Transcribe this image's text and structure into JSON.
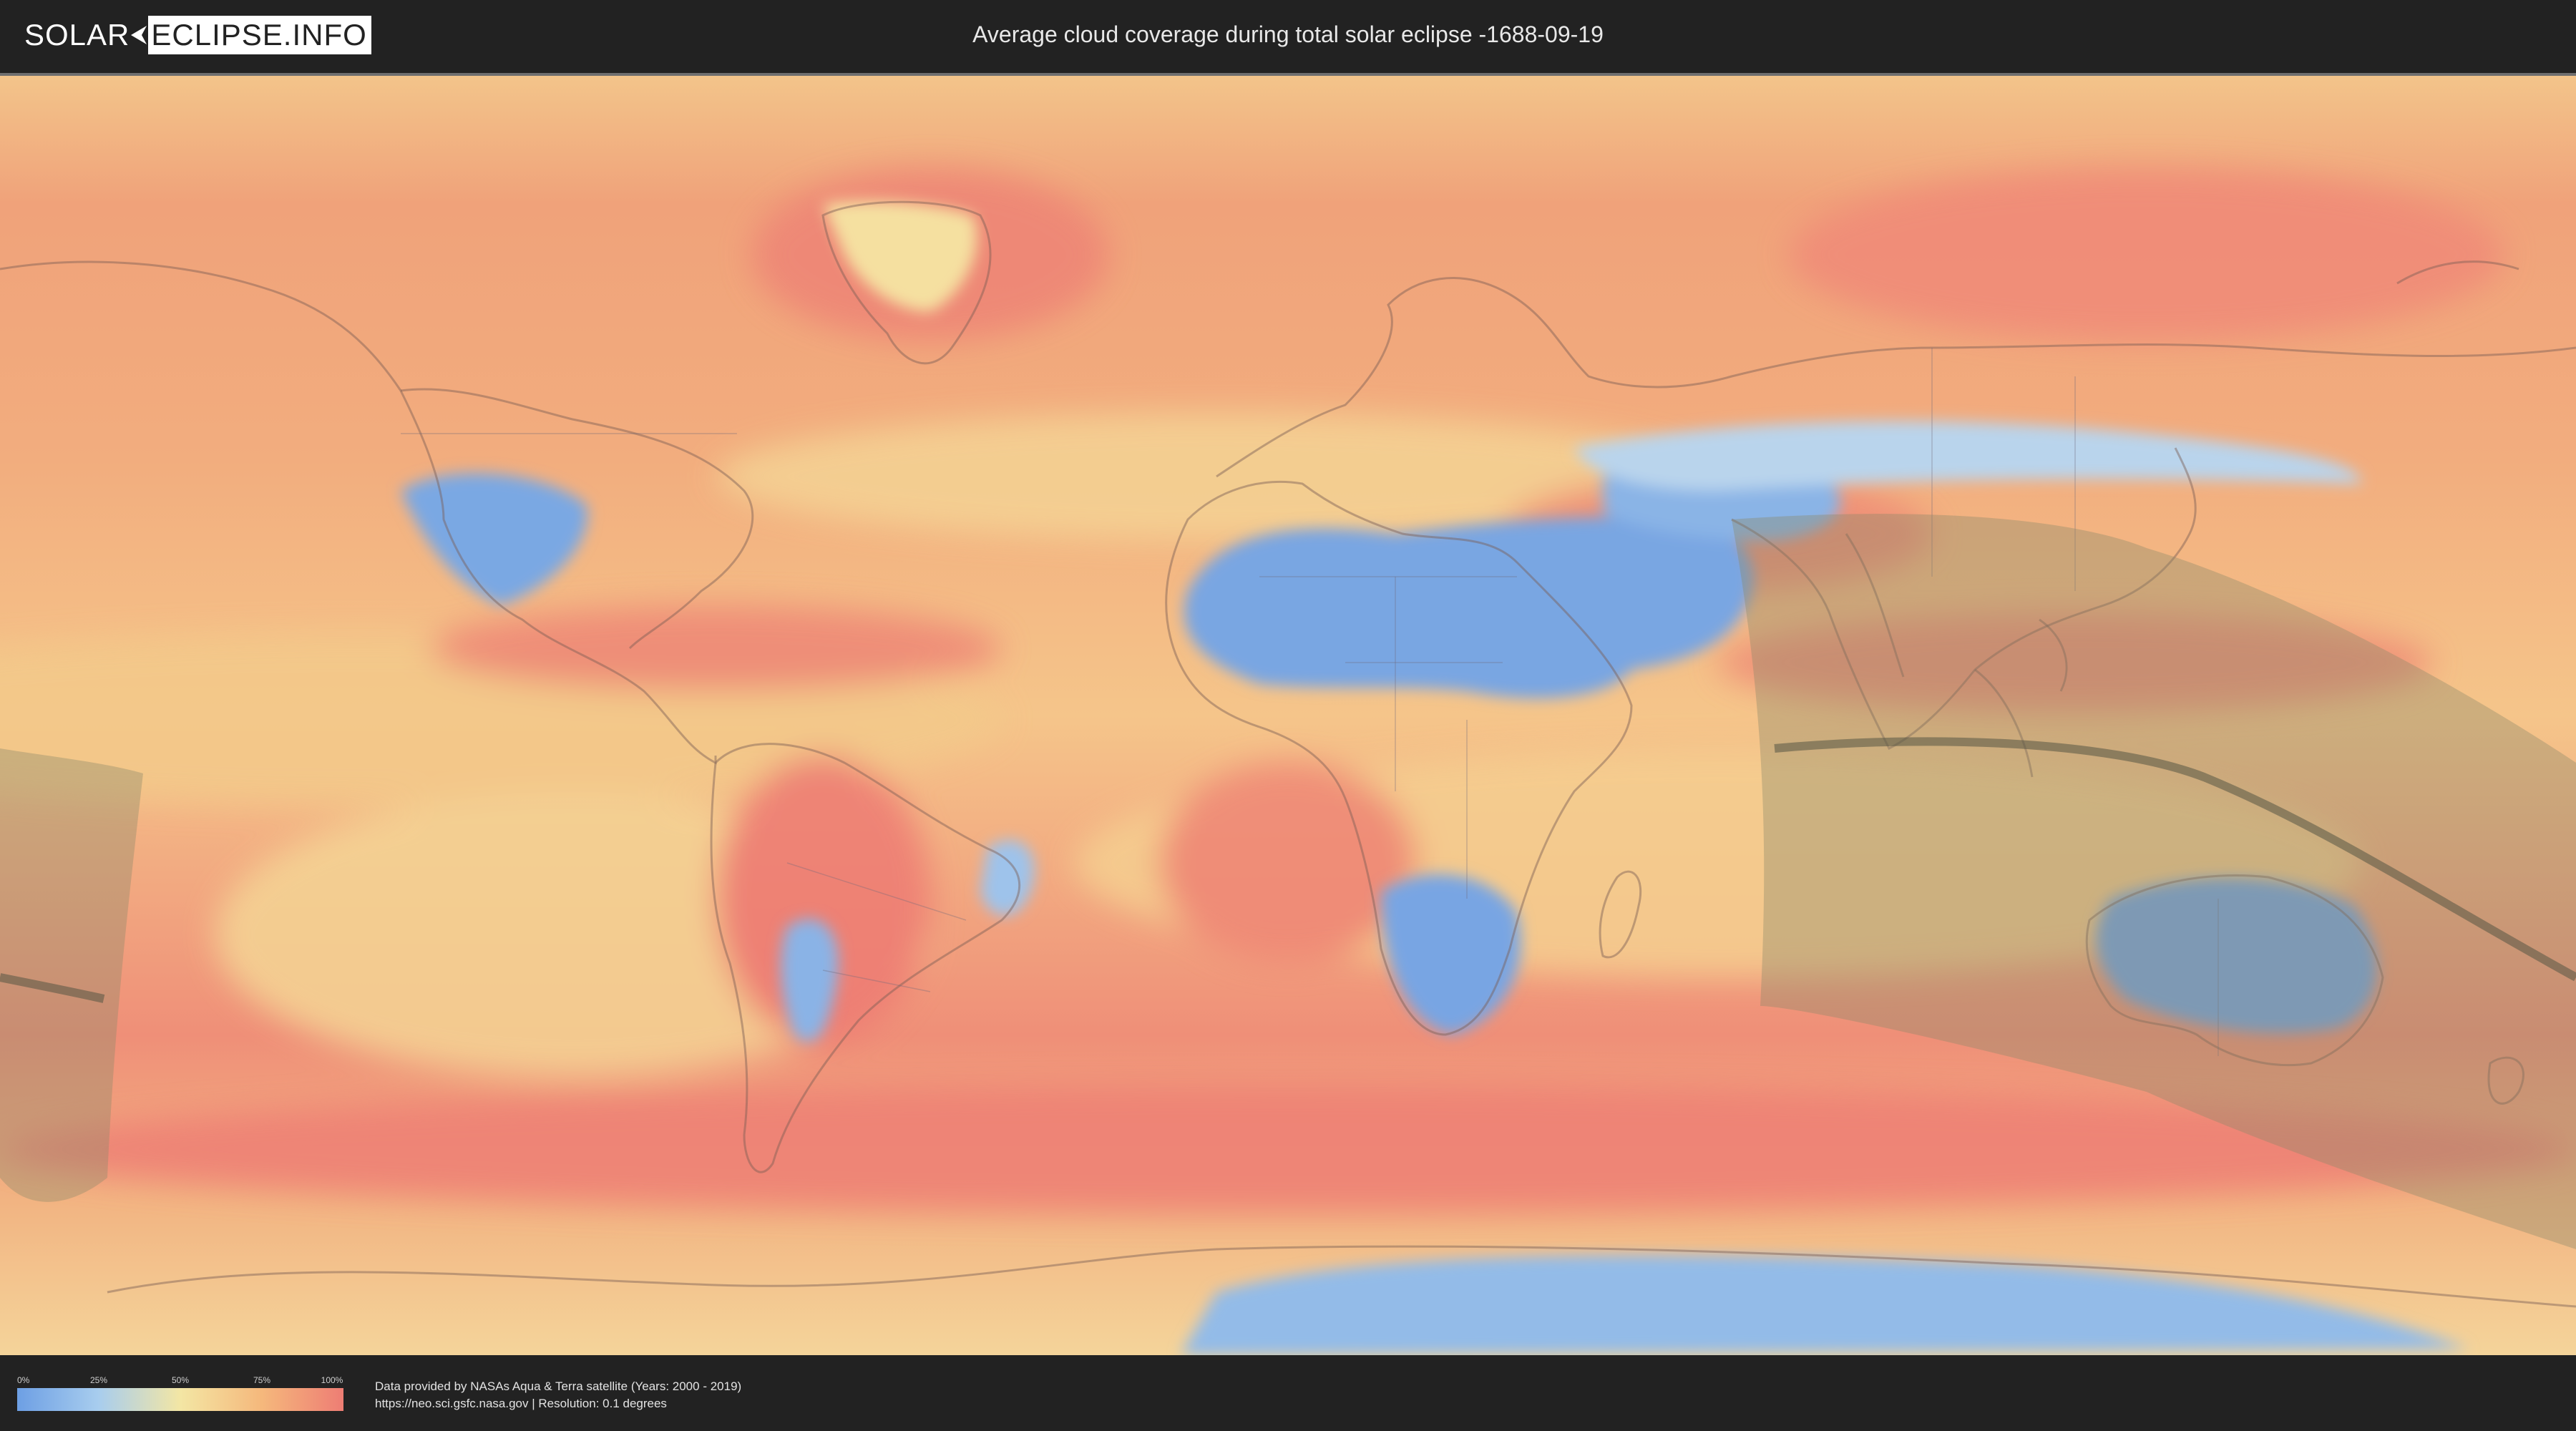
{
  "header": {
    "logo_left": "SOLAR",
    "logo_right": "ECLIPSE.INFO",
    "title": "Average cloud coverage during total solar eclipse -1688-09-19"
  },
  "map": {
    "background_color": "#f1a57c",
    "colors": {
      "clear": "#6d9fe4",
      "light": "#a8cdee",
      "medium": "#f3e6a4",
      "high": "#f5b87c",
      "overcast": "#ee7d74",
      "eclipse_band": "#8c8a6a",
      "central_line": "#555544",
      "coastline": "#7a5e55"
    }
  },
  "legend": {
    "ticks": [
      "0%",
      "25%",
      "50%",
      "75%",
      "100%"
    ],
    "gradient": [
      "#6d9fe4",
      "#a8cdee",
      "#f3e6a4",
      "#f5b87c",
      "#ee7d74"
    ]
  },
  "credits": {
    "line1": "Data provided by NASAs Aqua & Terra satellite (Years: 2000 - 2019)",
    "line2": "https://neo.sci.gsfc.nasa.gov | Resolution: 0.1 degrees"
  }
}
